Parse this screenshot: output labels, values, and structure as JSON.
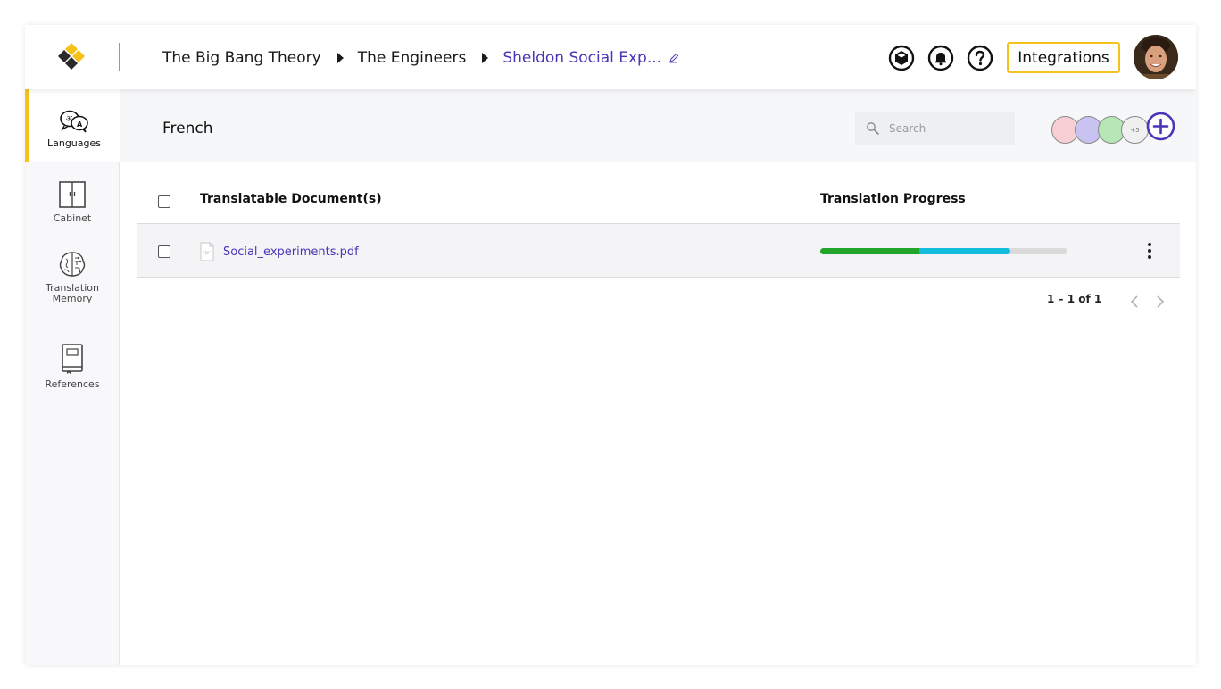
{
  "header": {
    "breadcrumb": [
      "The Big Bang Theory",
      "The Engineers",
      "Sheldon Social Exp..."
    ],
    "integrations_label": "Integrations",
    "icons": [
      "cube-icon",
      "bell-icon",
      "help-icon"
    ],
    "accent_color": "#f5c21b",
    "link_color": "#4a35b8"
  },
  "sidebar": {
    "items": [
      {
        "label": "Languages",
        "icon": "translate-icon",
        "active": true
      },
      {
        "label": "Cabinet",
        "icon": "cabinet-icon",
        "active": false
      },
      {
        "label": "Translation Memory",
        "icon": "brain-icon",
        "active": false
      },
      {
        "label": "References",
        "icon": "book-icon",
        "active": false
      }
    ]
  },
  "main": {
    "language": "French",
    "search_placeholder": "Search",
    "collaborators": {
      "colors": [
        "#f8cfd3",
        "#c8c3f0",
        "#b8e6b4"
      ],
      "more_label": "+5"
    },
    "table": {
      "columns": [
        "Translatable Document(s)",
        "Translation Progress"
      ],
      "rows": [
        {
          "file_type_label": "PDF",
          "file": "Social_experiments.pdf",
          "progress_done": 0.4,
          "progress_in_progress": 0.37
        }
      ]
    },
    "pagination": "1 – 1 of 1"
  }
}
